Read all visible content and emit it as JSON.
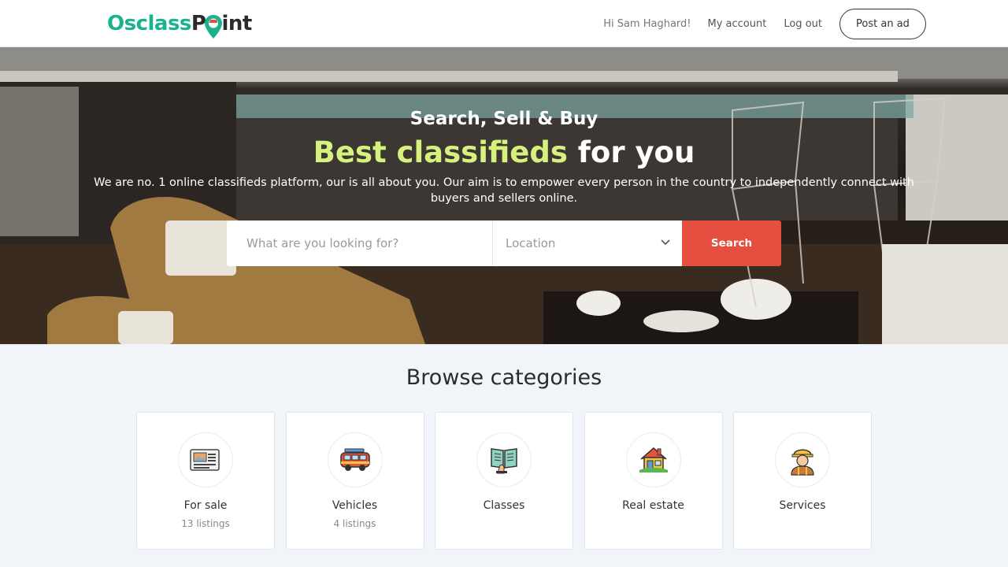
{
  "brand": {
    "part1": "Osclass",
    "part2": "P",
    "part3": "int"
  },
  "nav": {
    "greeting": "Hi Sam Haghard!",
    "my_account": "My account",
    "log_out": "Log out",
    "post_ad": "Post an ad"
  },
  "hero": {
    "title_line1": "Search, Sell & Buy",
    "title_highlight": "Best classifieds",
    "title_rest": "for you",
    "description": "We are no. 1 online classifieds platform, our is all about you. Our aim is to empower every person in the country to independently connect with buyers and sellers online."
  },
  "search": {
    "placeholder": "What are you looking for?",
    "location_label": "Location",
    "button_label": "Search"
  },
  "browse": {
    "title": "Browse categories",
    "categories": [
      {
        "name": "For sale",
        "count": "13 listings",
        "icon": "newspaper-icon"
      },
      {
        "name": "Vehicles",
        "count": "4 listings",
        "icon": "van-icon"
      },
      {
        "name": "Classes",
        "count": "",
        "icon": "book-icon"
      },
      {
        "name": "Real estate",
        "count": "",
        "icon": "house-icon"
      },
      {
        "name": "Services",
        "count": "",
        "icon": "worker-icon"
      }
    ]
  },
  "colors": {
    "brand_green": "#19b38e",
    "search_button": "#e54f3f",
    "highlight": "#d7f17f"
  }
}
